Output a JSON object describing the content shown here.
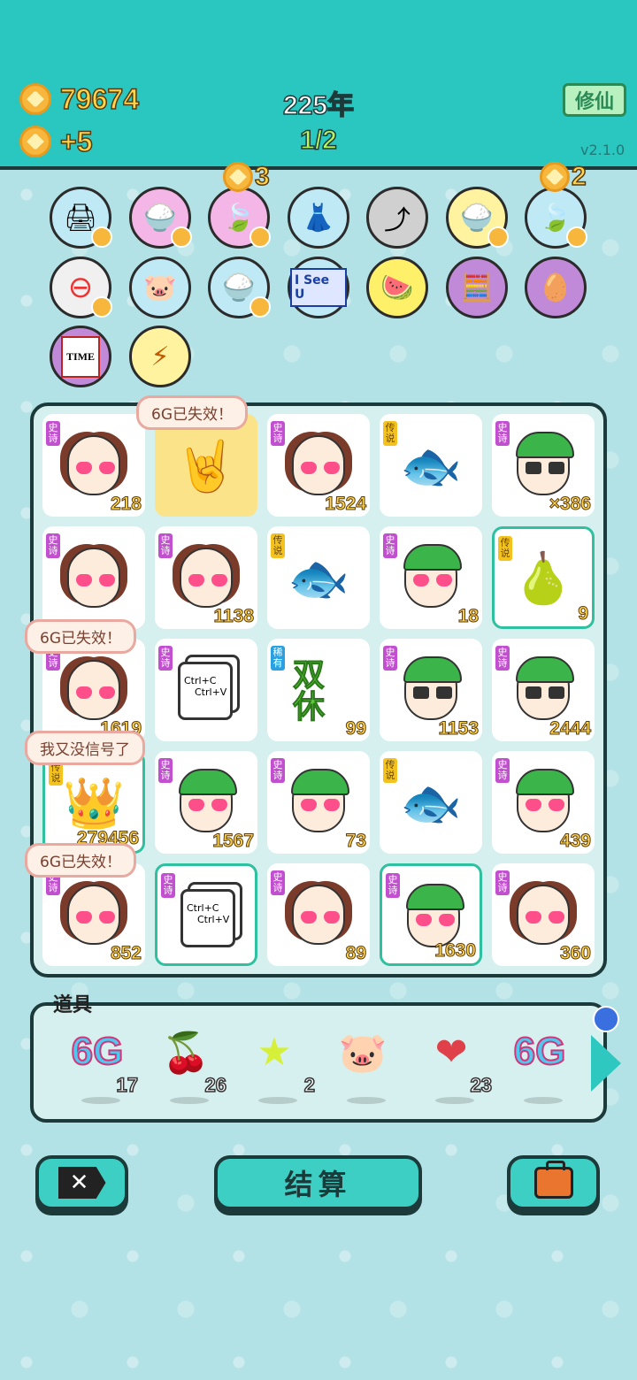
{
  "header": {
    "coins": "79674",
    "income": "+5",
    "year": "225年",
    "progress": "1/2",
    "xiuxian_label": "修仙",
    "version": "v2.1.0"
  },
  "skills": {
    "badge_a": "3",
    "badge_b": "2",
    "items": [
      "printer-icon",
      "rice-bowl-icon",
      "leaf-icon",
      "skirt-icon",
      "jump-card-icon",
      "rice-bowl-icon",
      "leaf-icon",
      "minus-icon",
      "piggy-bank-icon",
      "rice-bowl-icon",
      "i-see-u-icon",
      "fruit-basket-icon",
      "math-face-icon",
      "eyepatch-egg-icon",
      "time-magazine-icon",
      "lightning-icon"
    ],
    "i_see_u": "I See U",
    "time_label": "TIME"
  },
  "board": {
    "bubbles": [
      "6G已失效！",
      "6G已失效！",
      "我又没信号了",
      "6G已失效！"
    ],
    "tags": {
      "epic": "史诗",
      "legend": "传说",
      "rare": "稀有"
    },
    "cells": [
      {
        "tag": "史诗",
        "kind": "girl",
        "count": "218"
      },
      {
        "tag": "",
        "kind": "rock-hand",
        "count": ""
      },
      {
        "tag": "史诗",
        "kind": "girl",
        "count": "1524"
      },
      {
        "tag": "传说",
        "kind": "koi",
        "count": ""
      },
      {
        "tag": "史诗",
        "kind": "boy-glasses",
        "count": "×386"
      },
      {
        "tag": "史诗",
        "kind": "girl",
        "count": ""
      },
      {
        "tag": "史诗",
        "kind": "girl",
        "count": "1138"
      },
      {
        "tag": "传说",
        "kind": "koi",
        "count": ""
      },
      {
        "tag": "史诗",
        "kind": "boy",
        "count": "18"
      },
      {
        "tag": "传说",
        "kind": "pear",
        "count": "9"
      },
      {
        "tag": "史诗",
        "kind": "girl",
        "count": "1619"
      },
      {
        "tag": "史诗",
        "kind": "copy-paste",
        "count": ""
      },
      {
        "tag": "稀有",
        "kind": "shuangxiu",
        "count": "99"
      },
      {
        "tag": "史诗",
        "kind": "boy-glasses",
        "count": "1153"
      },
      {
        "tag": "史诗",
        "kind": "boy-glasses",
        "count": "2444"
      },
      {
        "tag": "传说",
        "kind": "king",
        "count": "279456"
      },
      {
        "tag": "史诗",
        "kind": "boy",
        "count": "1567"
      },
      {
        "tag": "史诗",
        "kind": "boy",
        "count": "73"
      },
      {
        "tag": "传说",
        "kind": "koi",
        "count": ""
      },
      {
        "tag": "史诗",
        "kind": "boy",
        "count": "439"
      },
      {
        "tag": "史诗",
        "kind": "girl",
        "count": "852"
      },
      {
        "tag": "史诗",
        "kind": "copy-paste",
        "count": ""
      },
      {
        "tag": "史诗",
        "kind": "girl",
        "count": "89"
      },
      {
        "tag": "史诗",
        "kind": "boy",
        "count": "1630"
      },
      {
        "tag": "史诗",
        "kind": "girl",
        "count": "360"
      }
    ],
    "copy_text": "Ctrl+C\nCtrl+V",
    "copy_line1": "Ctrl+C",
    "copy_line2": "Ctrl+V",
    "shuangxiu_text": "双休"
  },
  "props": {
    "title": "道具",
    "items": [
      {
        "icon": "6g-icon",
        "label": "6G",
        "count": "17"
      },
      {
        "icon": "bayberry-icon",
        "label": "",
        "count": "26"
      },
      {
        "icon": "star-icon",
        "label": "",
        "count": "2"
      },
      {
        "icon": "piggy-bank-icon",
        "label": "",
        "count": ""
      },
      {
        "icon": "liver-icon",
        "label": "",
        "count": "23"
      },
      {
        "icon": "6g-icon",
        "label": "6G",
        "count": ""
      }
    ]
  },
  "buttons": {
    "settle": "结算",
    "close_glyph": "✕"
  },
  "colors": {
    "header_bg": "#29c7c0",
    "accent": "#3ecfc4",
    "coin": "#f6b73c",
    "epic_tag": "#c24fd0",
    "legend_tag": "#f3c21e",
    "rare_tag": "#2aa0e0"
  }
}
